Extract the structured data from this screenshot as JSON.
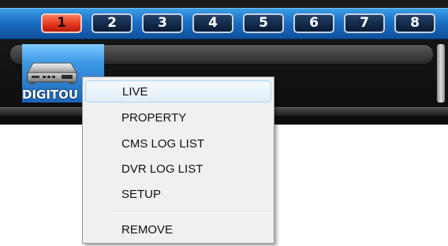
{
  "tabs": [
    {
      "label": "1",
      "active": true
    },
    {
      "label": "2",
      "active": false
    },
    {
      "label": "3",
      "active": false
    },
    {
      "label": "4",
      "active": false
    },
    {
      "label": "5",
      "active": false
    },
    {
      "label": "6",
      "active": false
    },
    {
      "label": "7",
      "active": false
    },
    {
      "label": "8",
      "active": false
    }
  ],
  "device": {
    "label": "DIGITOU",
    "icon": "dvr-device-icon"
  },
  "context_menu": {
    "items": [
      {
        "label": "LIVE"
      },
      {
        "label": "PROPERTY"
      },
      {
        "label": "CMS LOG LIST"
      },
      {
        "label": "DVR LOG LIST"
      },
      {
        "label": "SETUP"
      },
      {
        "label": "REMOVE"
      }
    ],
    "highlighted": "LIVE"
  },
  "colors": {
    "tab_bar": "#1a6fc4",
    "active_tab": "#e0341b",
    "menu_bg": "#f0f0f0",
    "menu_hover_border": "#a8d8f0"
  }
}
